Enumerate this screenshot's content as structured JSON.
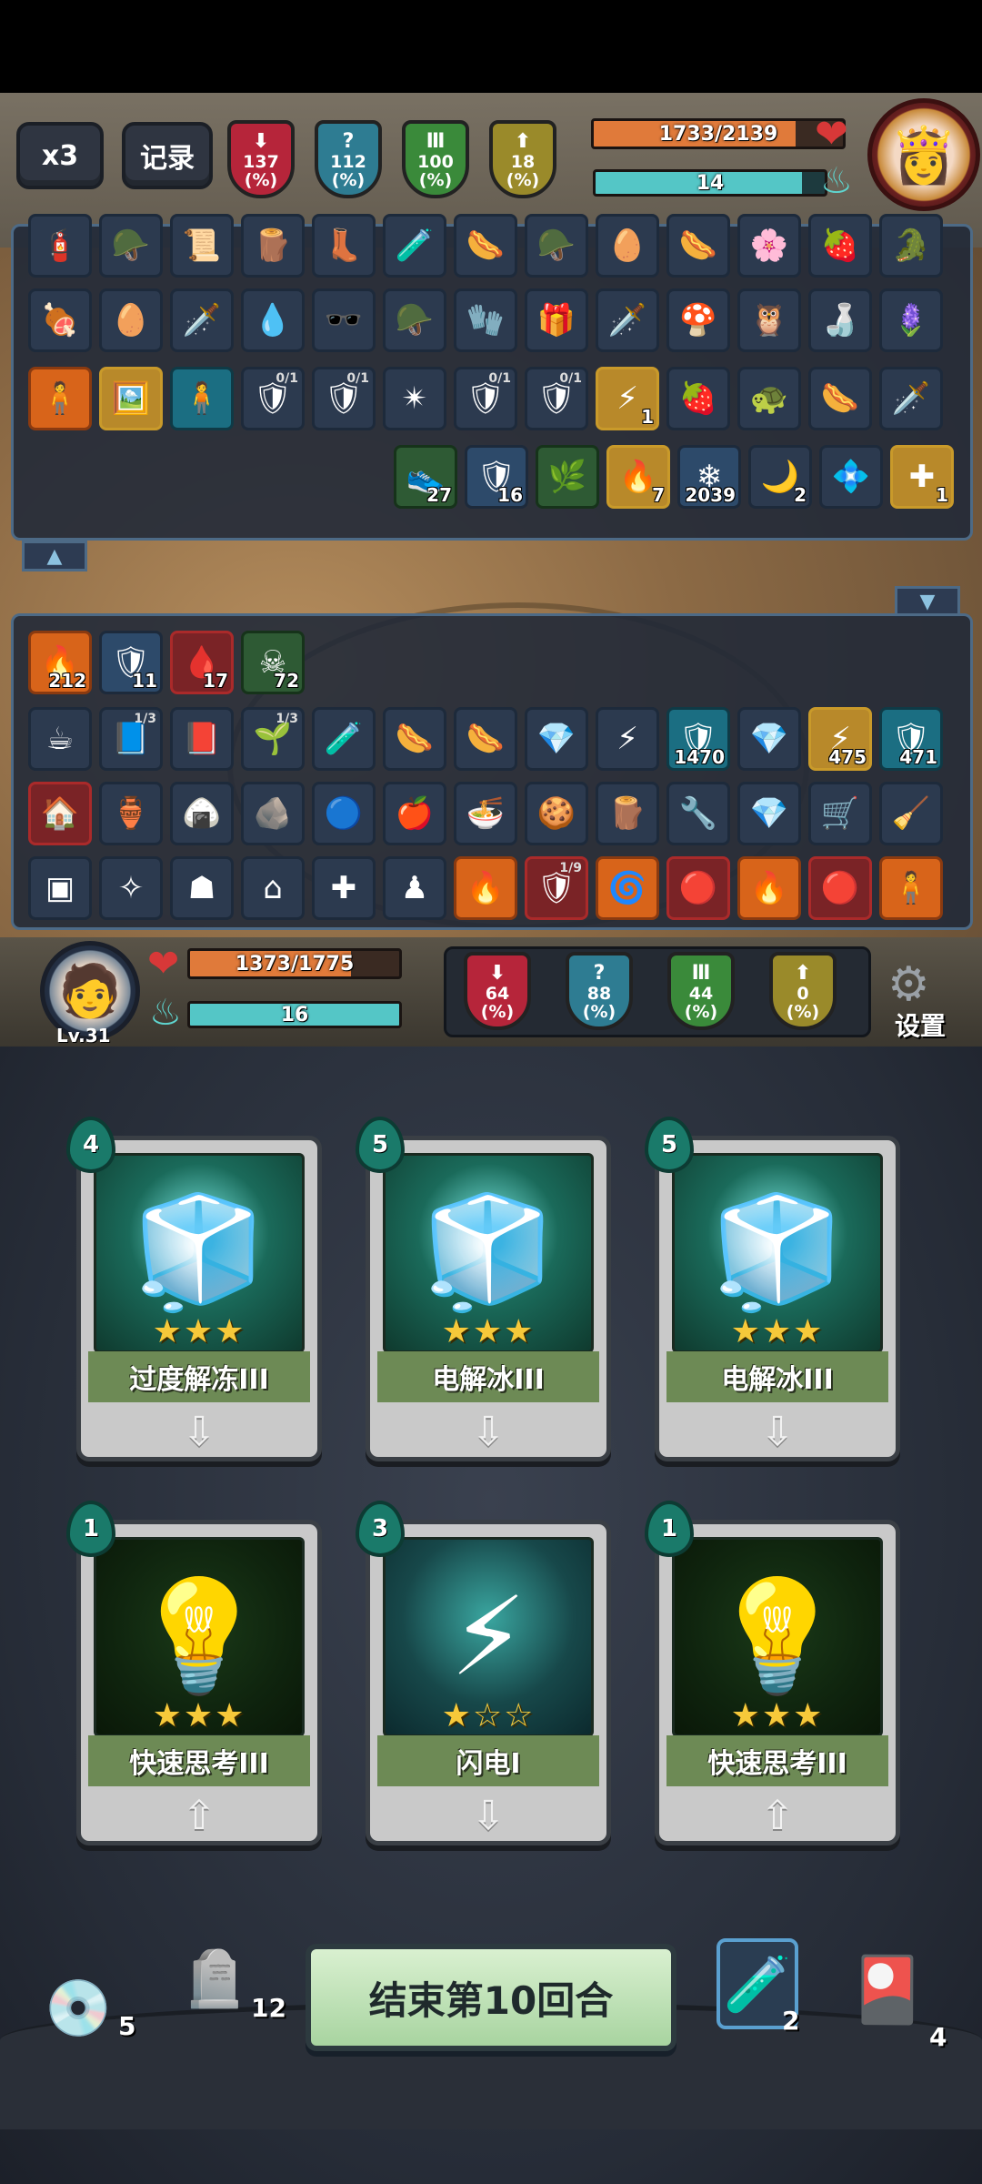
{
  "top": {
    "speed_label": "x3",
    "record_label": "记录"
  },
  "enemy": {
    "stats": [
      {
        "value": "137",
        "unit": "(%)",
        "icon": "sword-down-icon",
        "color": "#b6253a"
      },
      {
        "value": "112",
        "unit": "(%)",
        "icon": "question-icon",
        "color": "#2e7c92"
      },
      {
        "value": "100",
        "unit": "(%)",
        "icon": "pillar-icon",
        "color": "#3a8a3a"
      },
      {
        "value": "18",
        "unit": "(%)",
        "icon": "arrow-up-icon",
        "color": "#9a8a2a"
      }
    ],
    "hp_text": "1733/2139",
    "hp_fraction": 0.81,
    "mana_text": "14",
    "mana_fraction": 0.9
  },
  "enemy_items": {
    "row1": [
      "🧯",
      "🪖",
      "📜",
      "🪵",
      "👢",
      "🧪",
      "🌭",
      "🪖",
      "🥚",
      "🌭",
      "🌸",
      "🍓",
      "🐊"
    ],
    "row2": [
      "🍖",
      "🥚",
      "🗡️",
      "💧",
      "🕶️",
      "🪖",
      "🧤",
      "🎁",
      "🗡️",
      "🍄",
      "🦉",
      "🍶",
      "🪻"
    ],
    "row3": [
      {
        "icon": "🧍",
        "cls": "orange"
      },
      {
        "icon": "🖼️",
        "cls": "gold"
      },
      {
        "icon": "🧍",
        "cls": "teal"
      },
      {
        "icon": "🛡",
        "frac": "0/1"
      },
      {
        "icon": "🛡",
        "frac": "0/1"
      },
      {
        "icon": "✴"
      },
      {
        "icon": "🛡",
        "frac": "0/1"
      },
      {
        "icon": "🛡",
        "frac": "0/1"
      },
      {
        "icon": "⚡",
        "cnt": "1",
        "cls": "gold"
      },
      {
        "icon": "🍓"
      },
      {
        "icon": "🐢"
      },
      {
        "icon": "🌭"
      },
      {
        "icon": "🗡️"
      }
    ],
    "row4": [
      {
        "icon": "👟",
        "cnt": "27",
        "cls": "green"
      },
      {
        "icon": "🛡",
        "cnt": "16",
        "cls": "blue-icon"
      },
      {
        "icon": "🌿",
        "cnt": "",
        "cls": "green"
      },
      {
        "icon": "🔥",
        "cnt": "7",
        "cls": "gold"
      },
      {
        "icon": "❄",
        "cnt": "2039",
        "cls": "blue-icon"
      },
      {
        "icon": "🌙",
        "cnt": "2"
      },
      {
        "icon": "💠",
        "cnt": ""
      },
      {
        "icon": "✚",
        "cnt": "1",
        "cls": "gold"
      }
    ]
  },
  "player_items": {
    "row1": [
      {
        "icon": "🔥",
        "cnt": "212",
        "cls": "orange"
      },
      {
        "icon": "🛡",
        "cnt": "11",
        "cls": "blue-icon"
      },
      {
        "icon": "🩸",
        "cnt": "17",
        "cls": "red"
      },
      {
        "icon": "☠",
        "cnt": "72",
        "cls": "green"
      }
    ],
    "row2": [
      {
        "icon": "☕"
      },
      {
        "icon": "📘",
        "frac": "1/3"
      },
      {
        "icon": "📕"
      },
      {
        "icon": "🌱",
        "frac": "1/3"
      },
      {
        "icon": "🧪"
      },
      {
        "icon": "🌭"
      },
      {
        "icon": "🌭"
      },
      {
        "icon": "💎"
      },
      {
        "icon": "⚡"
      },
      {
        "icon": "🛡",
        "cnt": "1470",
        "cls": "teal"
      },
      {
        "icon": "💎"
      },
      {
        "icon": "⚡",
        "cnt": "475",
        "cls": "gold"
      },
      {
        "icon": "🛡",
        "cnt": "471",
        "cls": "teal"
      }
    ],
    "row3": [
      {
        "icon": "🏠",
        "cls": "red"
      },
      {
        "icon": "🏺"
      },
      {
        "icon": "🍙"
      },
      {
        "icon": "🪨"
      },
      {
        "icon": "🔵"
      },
      {
        "icon": "🍎"
      },
      {
        "icon": "🍜"
      },
      {
        "icon": "🍪"
      },
      {
        "icon": "🪵"
      },
      {
        "icon": "🔧"
      },
      {
        "icon": "💎"
      },
      {
        "icon": "🛒"
      },
      {
        "icon": "🧹"
      }
    ],
    "row4": [
      {
        "icon": "▣"
      },
      {
        "icon": "✧"
      },
      {
        "icon": "☗"
      },
      {
        "icon": "⌂"
      },
      {
        "icon": "✚"
      },
      {
        "icon": "♟"
      },
      {
        "icon": "🔥",
        "cls": "orange"
      },
      {
        "icon": "🛡",
        "frac": "1/9",
        "cls": "red"
      },
      {
        "icon": "🌀",
        "cls": "orange"
      },
      {
        "icon": "🔴",
        "cls": "red"
      },
      {
        "icon": "🔥",
        "cls": "orange"
      },
      {
        "icon": "🔴",
        "cls": "red"
      },
      {
        "icon": "🧍",
        "cls": "orange"
      }
    ]
  },
  "player": {
    "level": "Lv.31",
    "hp_text": "1373/1775",
    "hp_fraction": 0.77,
    "mana_text": "16",
    "mana_fraction": 1.0,
    "stats": [
      {
        "value": "64",
        "unit": "(%)",
        "color": "#b6253a"
      },
      {
        "value": "88",
        "unit": "(%)",
        "color": "#2e7c92"
      },
      {
        "value": "44",
        "unit": "(%)",
        "color": "#3a8a3a"
      },
      {
        "value": "0",
        "unit": "(%)",
        "color": "#9a8a2a"
      }
    ],
    "settings_label": "设置"
  },
  "cards": [
    {
      "cost": "4",
      "name": "过度解冻III",
      "stars": "★★★",
      "art": "🧊",
      "dir": "down",
      "style": "ice"
    },
    {
      "cost": "5",
      "name": "电解冰III",
      "stars": "★★★",
      "art": "🧊",
      "dir": "down",
      "style": "ice"
    },
    {
      "cost": "5",
      "name": "电解冰III",
      "stars": "★★★",
      "art": "🧊",
      "dir": "down",
      "style": "ice"
    },
    {
      "cost": "1",
      "name": "快速思考III",
      "stars": "★★★",
      "art": "💡",
      "dir": "up",
      "style": "dark"
    },
    {
      "cost": "3",
      "name": "闪电I",
      "stars": "★☆☆",
      "art": "⚡",
      "dir": "down",
      "style": "bolt"
    },
    {
      "cost": "1",
      "name": "快速思考III",
      "stars": "★★★",
      "art": "💡",
      "dir": "up",
      "style": "dark"
    }
  ],
  "bottom": {
    "draw_pile_count": "5",
    "grave_count": "12",
    "end_turn_label": "结束第10回合",
    "potion_count": "2",
    "discard_count": "4"
  }
}
